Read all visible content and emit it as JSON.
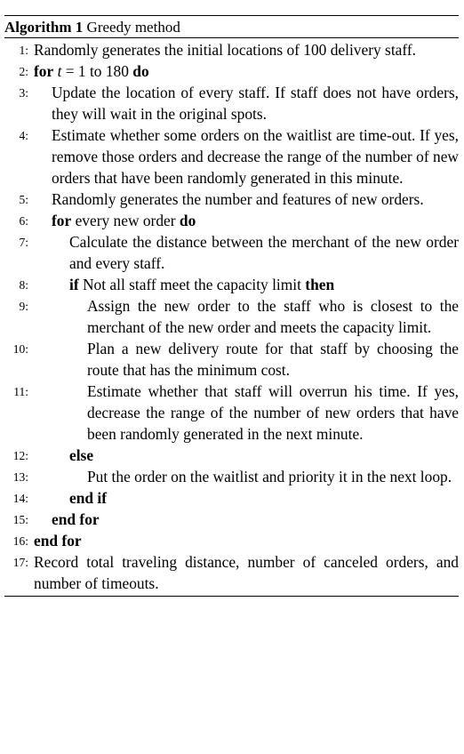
{
  "algorithm": {
    "label": "Algorithm 1",
    "title": "Greedy method",
    "lines": [
      {
        "num": "1:",
        "level": 0,
        "parts": [
          {
            "t": "Randomly generates the initial locations of 100 delivery staff."
          }
        ]
      },
      {
        "num": "2:",
        "level": 0,
        "parts": [
          {
            "t": "for",
            "kw": true
          },
          {
            "t": " "
          },
          {
            "t": "t",
            "math": true
          },
          {
            "t": " = 1 to 180 "
          },
          {
            "t": "do",
            "kw": true
          }
        ]
      },
      {
        "num": "3:",
        "level": 1,
        "parts": [
          {
            "t": "Update the location of every staff. If staff does not have orders, they will wait in the original spots."
          }
        ]
      },
      {
        "num": "4:",
        "level": 1,
        "parts": [
          {
            "t": "Estimate whether some orders on the waitlist are time-out. If yes, remove those orders and decrease the range of the number of new orders that have been randomly generated in this minute."
          }
        ]
      },
      {
        "num": "5:",
        "level": 1,
        "parts": [
          {
            "t": "Randomly generates the number and features of new orders."
          }
        ]
      },
      {
        "num": "6:",
        "level": 1,
        "parts": [
          {
            "t": "for",
            "kw": true
          },
          {
            "t": " every new order "
          },
          {
            "t": "do",
            "kw": true
          }
        ]
      },
      {
        "num": "7:",
        "level": 2,
        "parts": [
          {
            "t": "Calculate the distance between the merchant of the new order and every staff."
          }
        ]
      },
      {
        "num": "8:",
        "level": 2,
        "parts": [
          {
            "t": "if",
            "kw": true
          },
          {
            "t": " Not all staff meet the capacity limit "
          },
          {
            "t": "then",
            "kw": true
          }
        ]
      },
      {
        "num": "9:",
        "level": 3,
        "parts": [
          {
            "t": "Assign the new order to the staff who is closest to the merchant of the new order and meets the capacity limit."
          }
        ]
      },
      {
        "num": "10:",
        "level": 3,
        "parts": [
          {
            "t": "Plan a new delivery route for that staff by choosing the route that has the minimum cost."
          }
        ]
      },
      {
        "num": "11:",
        "level": 3,
        "parts": [
          {
            "t": "Estimate whether that staff will overrun his time. If yes, decrease the range of the number of new orders that have been randomly generated in the next minute."
          }
        ]
      },
      {
        "num": "12:",
        "level": 2,
        "parts": [
          {
            "t": "else",
            "kw": true
          }
        ]
      },
      {
        "num": "13:",
        "level": 3,
        "parts": [
          {
            "t": "Put the order on the waitlist and priority it in the next loop."
          }
        ]
      },
      {
        "num": "14:",
        "level": 2,
        "parts": [
          {
            "t": "end if",
            "kw": true
          }
        ]
      },
      {
        "num": "15:",
        "level": 1,
        "parts": [
          {
            "t": "end for",
            "kw": true
          }
        ]
      },
      {
        "num": "16:",
        "level": 0,
        "parts": [
          {
            "t": "end for",
            "kw": true
          }
        ]
      },
      {
        "num": "17:",
        "level": 0,
        "parts": [
          {
            "t": "Record total traveling distance, number of canceled orders, and number of timeouts."
          }
        ]
      }
    ]
  }
}
